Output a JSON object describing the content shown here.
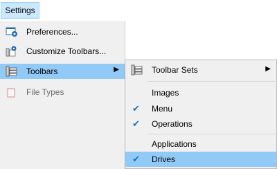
{
  "menubar": {
    "title": "Settings"
  },
  "dropdown": {
    "items": [
      {
        "label": "Preferences...",
        "icon": "preferences-icon"
      },
      {
        "label": "Customize Toolbars...",
        "icon": "customize-toolbars-icon"
      },
      {
        "label": "Toolbars",
        "icon": "toolbars-icon",
        "has_submenu": true,
        "highlighted": true
      },
      {
        "label": "File Types",
        "icon": "file-types-icon"
      }
    ]
  },
  "submenu": {
    "items": [
      {
        "label": "Toolbar Sets",
        "icon": "toolbar-sets-icon",
        "has_submenu": true
      },
      {
        "label": "Images",
        "checked": false
      },
      {
        "label": "Menu",
        "checked": true
      },
      {
        "label": "Operations",
        "checked": true
      },
      {
        "label": "Applications",
        "checked": false
      },
      {
        "label": "Drives",
        "checked": true,
        "highlighted": true
      }
    ]
  },
  "colors": {
    "highlight": "#91c9f7",
    "menu_bg": "#f0f0f0",
    "check": "#1a6fb5"
  },
  "glyphs": {
    "arrow": "▶",
    "check": "✔"
  }
}
